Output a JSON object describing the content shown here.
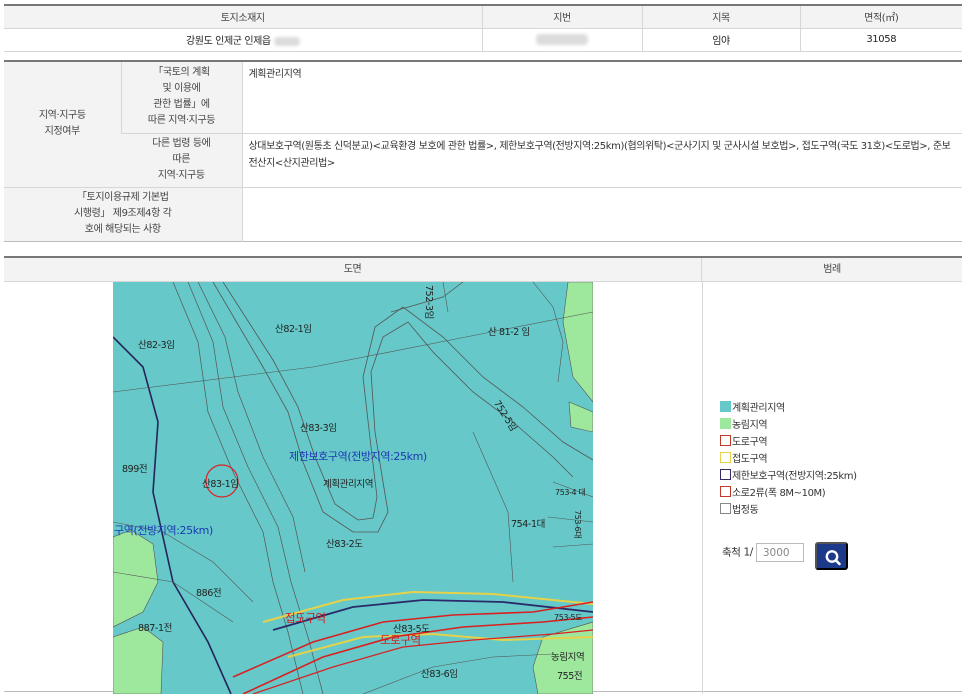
{
  "parcel": {
    "headers": [
      "토지소재지",
      "지번",
      "지목",
      "면적(㎡)"
    ],
    "location": "강원도 인제군 인제읍",
    "land_category": "임야",
    "area": "31058"
  },
  "zoning": {
    "row_label": "지역·지구등\n지정여부",
    "national_label": "「국토의 계획\n및 이용에\n관한 법률」에\n따른 지역·지구등",
    "national_value": "계획관리지역",
    "other_label": "다른 법령 등에\n따른\n지역·지구등",
    "other_value": "상대보호구역(원통초 신덕분교)<교육환경 보호에 관한 법률>, 제한보호구역(전방지역:25km)(협의위탁)<군사기지 및 군사시설 보호법>, 접도구역(국도 31호)<도로법>, 준보전산지<산지관리법>",
    "enforcement_label": "「토지이용규제 기본법\n시행령」 제9조제4항 각\n호에 해당되는 사항",
    "enforcement_value": ""
  },
  "map_panel": {
    "map_header": "도면",
    "legend_header": "범례",
    "labels": {
      "l1": "산82-1임",
      "l2": "산82-3임",
      "l3": "산 81-2 임",
      "l4": "752-3임",
      "l5": "752-5임",
      "l6": "산83-3임",
      "l7": "제한보호구역(전방지역:25km)",
      "l8": "899전",
      "l9": "산83-1임",
      "l10": "계획관리지역",
      "l11": "구역(전방지역:25km)",
      "l12": "산83-2도",
      "l13": "754-1대",
      "l14": "753-4 대",
      "l15": "753-6대",
      "l16": "886전",
      "l17": "887-1전",
      "l18": "접도구역",
      "l19": "산83-5도",
      "l20": "도로구역",
      "l21": "산83-6임",
      "l22": "농림지역",
      "l23": "755전",
      "l24": "753-5도"
    }
  },
  "legend": {
    "items": [
      {
        "label": "계획관리지역",
        "fill": "#66c8c8",
        "border": "#66c8c8"
      },
      {
        "label": "농림지역",
        "fill": "#9ee89e",
        "border": "#9ee89e"
      },
      {
        "label": "도로구역",
        "fill": "#ffffff",
        "border": "#c0392b"
      },
      {
        "label": "접도구역",
        "fill": "#ffffff",
        "border": "#e6d24a"
      },
      {
        "label": "제한보호구역(전방지역:25km)",
        "fill": "#ffffff",
        "border": "#3a2a6a"
      },
      {
        "label": "소로2류(폭 8M~10M)",
        "fill": "#ffffff",
        "border": "#c0392b"
      },
      {
        "label": "법정동",
        "fill": "#ffffff",
        "border": "#888888"
      }
    ],
    "scale_label": "축척 1/",
    "scale_value": "3000"
  },
  "colors": {
    "planning_zone": "#66c8c8",
    "farm_zone": "#9ee89e",
    "road": "#d92020",
    "setback": "#e6d24a",
    "restricted": "#2a2a6a",
    "search_button": "#1d3a8a"
  },
  "icons": {
    "search_button": "search-icon"
  }
}
